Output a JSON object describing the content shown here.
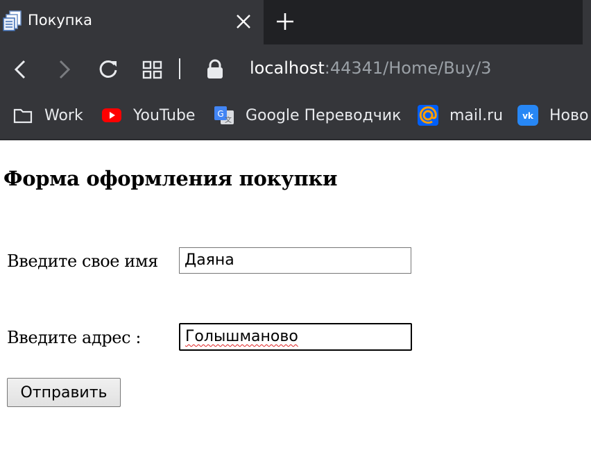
{
  "browser": {
    "tab": {
      "title": "Покупка"
    },
    "address": {
      "host": "localhost",
      "rest": ":44341/Home/Buy/3"
    },
    "bookmarks": [
      {
        "label": "Work",
        "icon": "folder-icon"
      },
      {
        "label": "YouTube",
        "icon": "youtube-icon"
      },
      {
        "label": "Google Переводчик",
        "icon": "google-translate-icon"
      },
      {
        "label": "mail.ru",
        "icon": "mailru-icon"
      },
      {
        "label": "Ново",
        "icon": "vk-icon"
      }
    ],
    "colors": {
      "tabstrip": "#202124",
      "toolbar": "#35363a",
      "text": "#e8eaed"
    }
  },
  "page": {
    "title": "Форма оформления покупки",
    "form": {
      "name_label": "Введите свое имя",
      "name_value": "Даяна",
      "address_label": "Введите адрес :",
      "address_value": "Голышманово",
      "submit_label": "Отправить"
    }
  }
}
